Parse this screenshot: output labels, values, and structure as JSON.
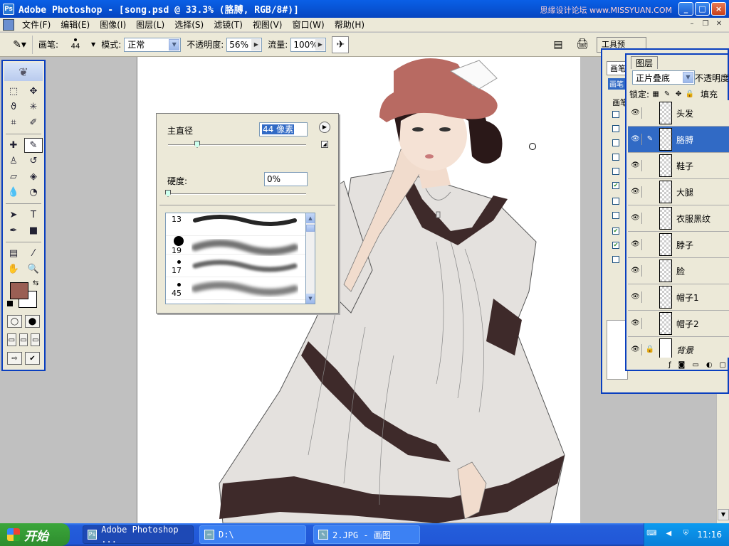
{
  "window": {
    "title": "Adobe Photoshop - [song.psd @ 33.3% (胳膊, RGB/8#)]",
    "watermark": "思缘设计论坛 www.MISSYUAN.COM"
  },
  "menu": {
    "items": [
      "文件(F)",
      "编辑(E)",
      "图像(I)",
      "图层(L)",
      "选择(S)",
      "滤镜(T)",
      "视图(V)",
      "窗口(W)",
      "帮助(H)"
    ]
  },
  "options": {
    "brush_label": "画笔:",
    "brush_size": "44",
    "mode_label": "模式:",
    "mode_value": "正常",
    "opacity_label": "不透明度:",
    "opacity_value": "56%",
    "flow_label": "流量:",
    "flow_value": "100%",
    "palette_well_label": "工具预"
  },
  "brush_popup": {
    "diameter_label": "主直径",
    "diameter_value": "44 像素",
    "hardness_label": "硬度:",
    "hardness_value": "0%",
    "presets": [
      {
        "size": "13"
      },
      {
        "size": "19"
      },
      {
        "size": "17"
      },
      {
        "size": "45"
      },
      {
        "size": ""
      }
    ]
  },
  "brushes_palette": {
    "tab": "画笔",
    "header": "画笔",
    "sub": "画笔"
  },
  "layers": {
    "tab": "图层",
    "blend_mode": "正片叠底",
    "opacity_label": "不透明度",
    "lock_label": "锁定:",
    "fill_label": "填充",
    "items": [
      {
        "name": "头发",
        "visible": true,
        "selected": false
      },
      {
        "name": "胳膊",
        "visible": true,
        "selected": true
      },
      {
        "name": "鞋子",
        "visible": true,
        "selected": false
      },
      {
        "name": "大腿",
        "visible": true,
        "selected": false
      },
      {
        "name": "衣服黑纹",
        "visible": true,
        "selected": false
      },
      {
        "name": "脖子",
        "visible": true,
        "selected": false
      },
      {
        "name": "脸",
        "visible": true,
        "selected": false
      },
      {
        "name": "帽子1",
        "visible": true,
        "selected": false
      },
      {
        "name": "帽子2",
        "visible": true,
        "selected": false
      },
      {
        "name": "背景",
        "visible": true,
        "selected": false
      }
    ]
  },
  "colors": {
    "foreground": "#9a5f54",
    "background": "#ffffff",
    "title_bar": "#0856d8",
    "selection": "#316ac5"
  },
  "taskbar": {
    "start_label": "开始",
    "tasks": [
      {
        "label": "Adobe Photoshop ..."
      },
      {
        "label": "D:\\"
      },
      {
        "label": "2.JPG - 画图"
      }
    ],
    "clock": "11:16"
  }
}
